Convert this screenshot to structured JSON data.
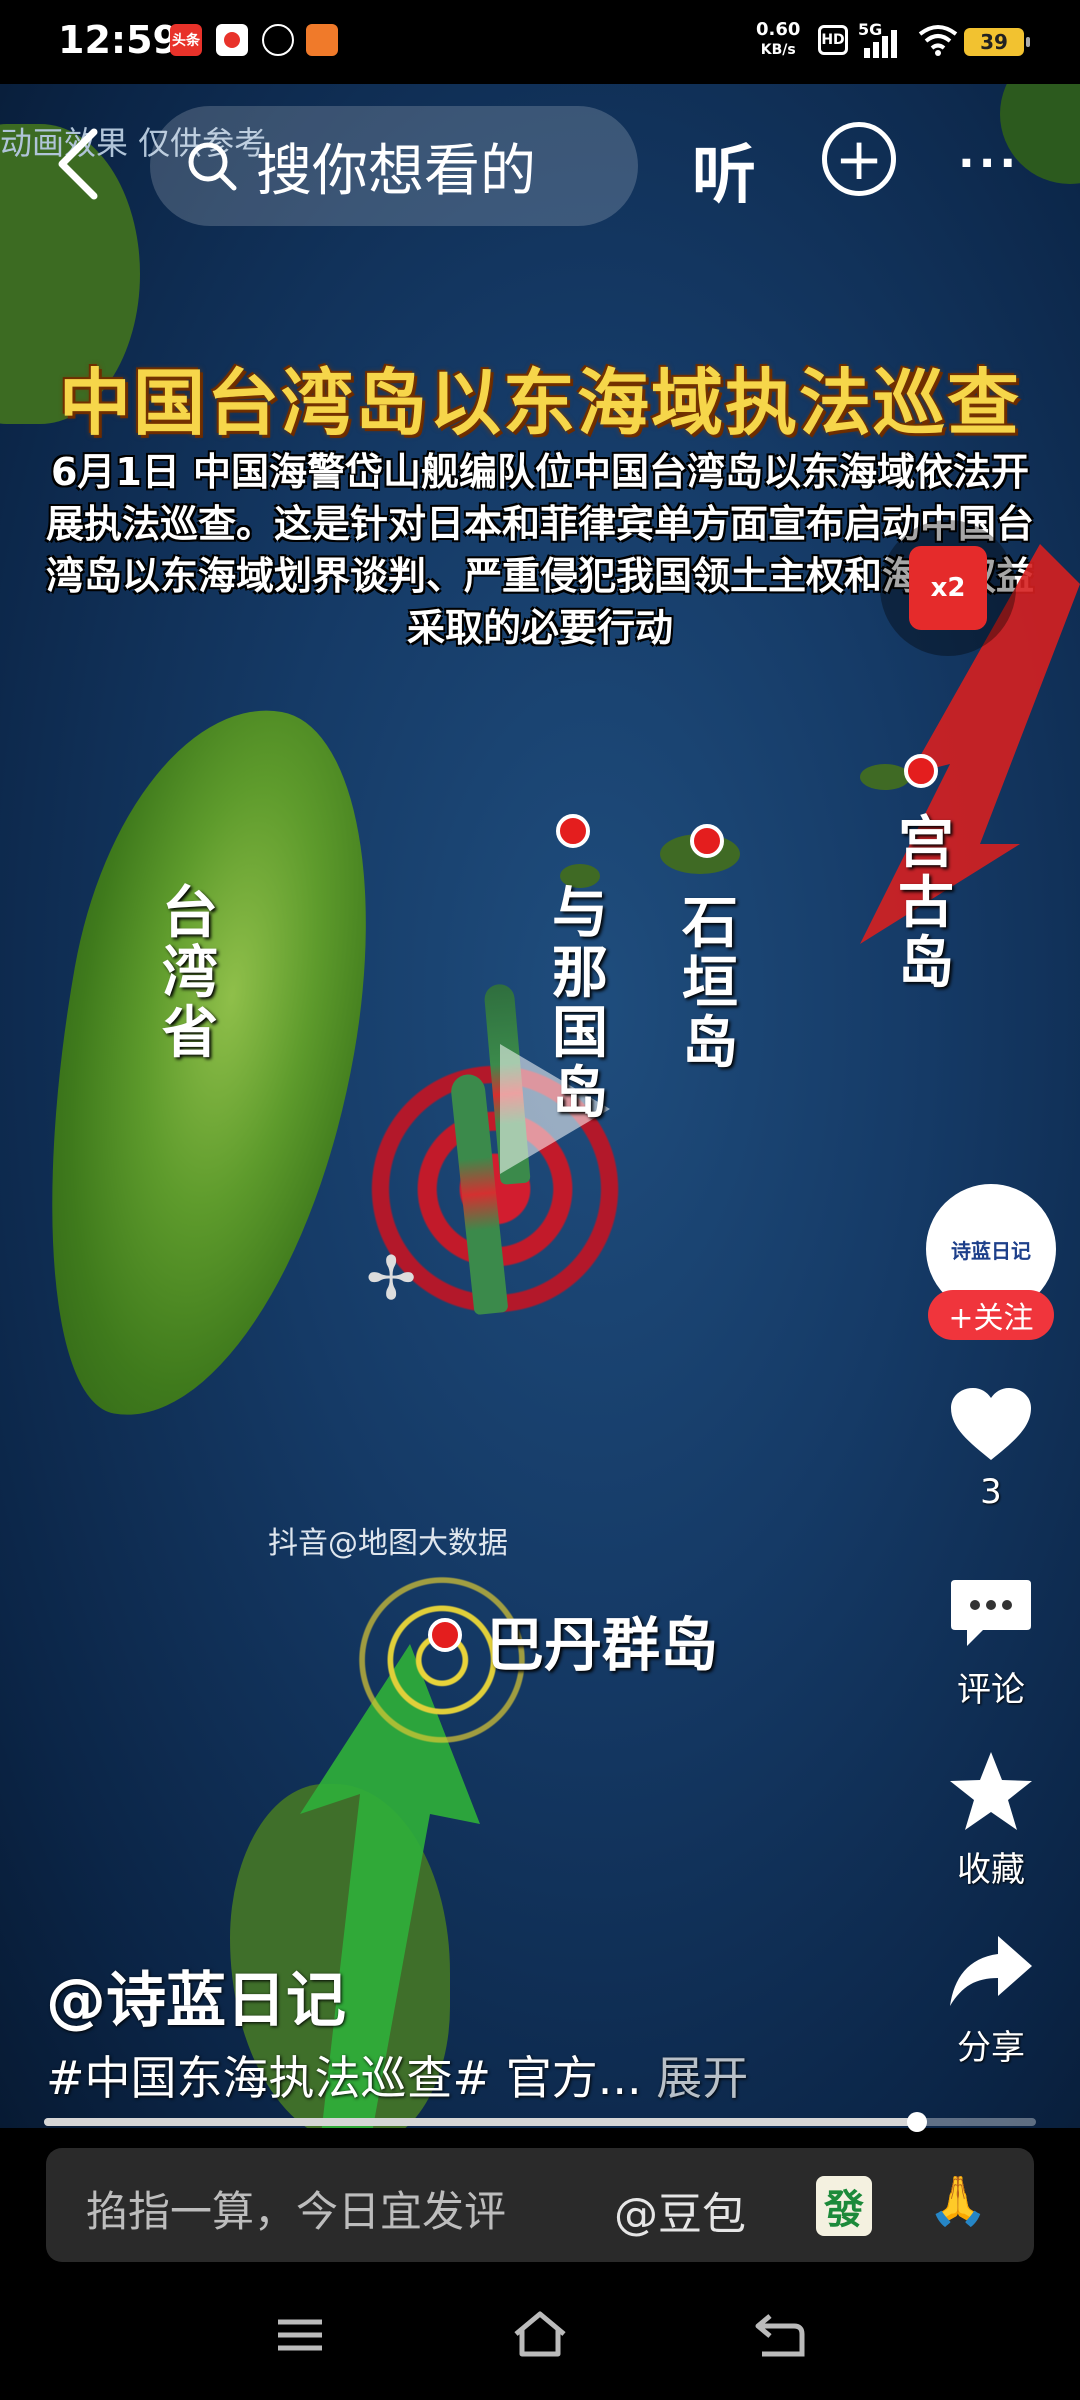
{
  "status_bar": {
    "time": "12:59",
    "net_speed_value": "0.60",
    "net_speed_unit": "KB/s",
    "hd_label": "HD",
    "network": "5G",
    "battery": "39",
    "notification_icons": [
      {
        "name": "toutiao-icon",
        "text": "头条",
        "color": "#e8322a"
      },
      {
        "name": "app-icon",
        "text": "",
        "color": "#e8322a"
      },
      {
        "name": "app-icon-2",
        "text": "",
        "color": "#ffffff"
      },
      {
        "name": "app-icon-3",
        "text": "",
        "color": "#f07a2a"
      }
    ]
  },
  "top_bar": {
    "search_placeholder": "搜你想看的",
    "listen_label": "听",
    "plus_label": "+",
    "more_label": "···"
  },
  "video": {
    "top_text": "动画效果 仅供参考",
    "title": "中国台湾岛以东海域执法巡查",
    "subtitle": "6月1日 中国海警岱山舰编队位中国台湾岛以东海域依法开展执法巡查。这是针对日本和菲律宾单方面宣布启动中国台湾岛以东海域划界谈判、严重侵犯我国领土主权和海洋权益采取的必要行动",
    "labels": {
      "taiwan": "台湾省",
      "yonaguni": "与那国岛",
      "ishigaki": "石垣岛",
      "miyako": "宫古岛",
      "batanes": "巴丹群岛"
    },
    "watermark": "抖音@地图大数据",
    "red_packet_label": "x2"
  },
  "sidebar": {
    "avatar_text": "诗蓝日记",
    "follow_label": "+关注",
    "like_count": "3",
    "comment_label": "评论",
    "favorite_label": "收藏",
    "share_label": "分享"
  },
  "info": {
    "author": "@诗蓝日记",
    "description": "#中国东海执法巡查# 官方...",
    "expand_label": "展开",
    "progress": 0.88
  },
  "comment_bar": {
    "placeholder": "掐指一算，今日宜发评",
    "at_label": "@豆包",
    "mahjong_tile": "發",
    "hands_emoji": "🙏"
  },
  "colors": {
    "accent_red": "#f0353c",
    "title_yellow": "#f6d64a",
    "sea_blue": "#153a66"
  }
}
